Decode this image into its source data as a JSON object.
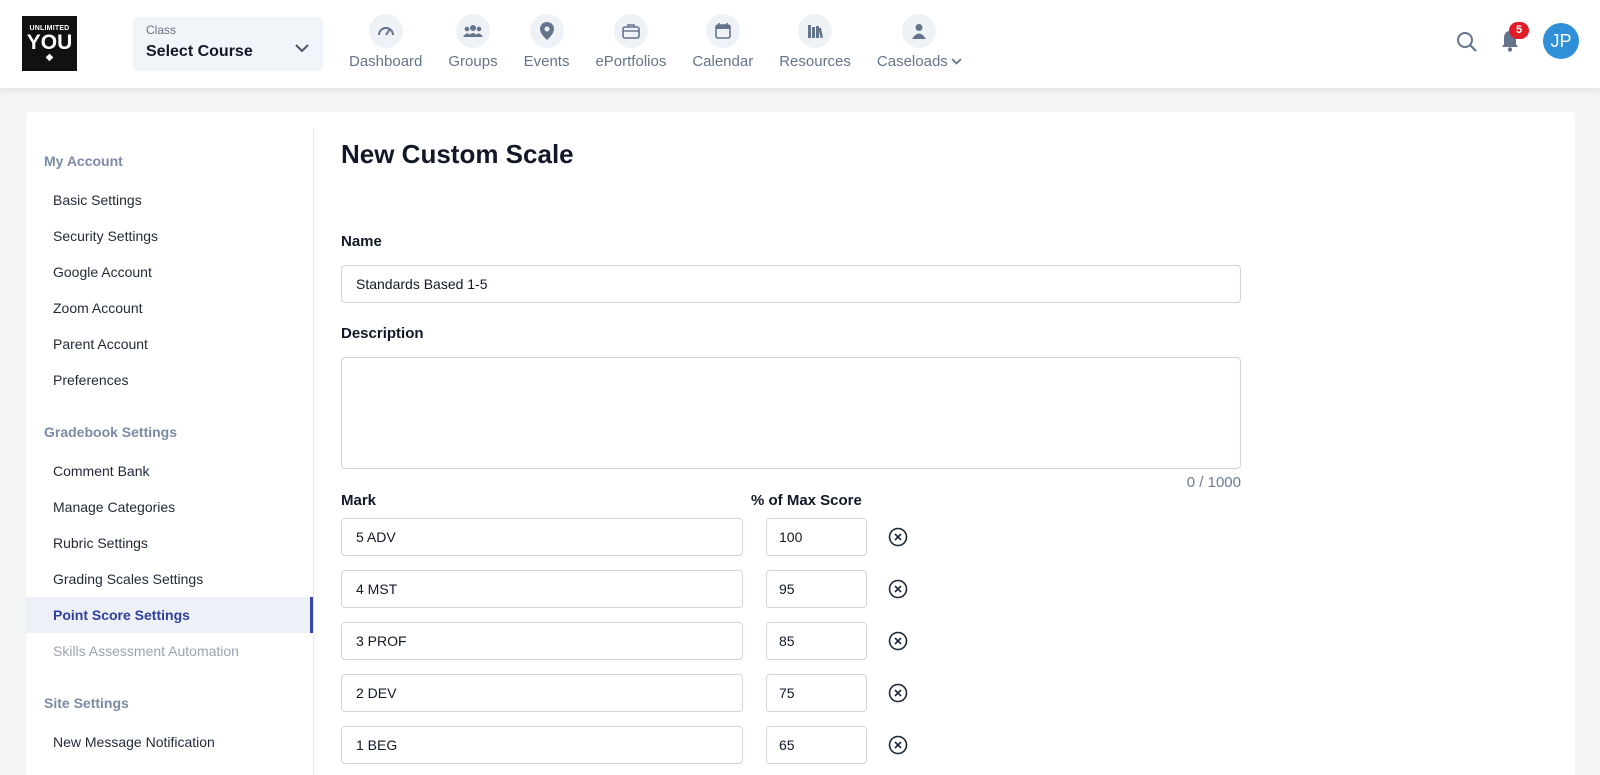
{
  "header": {
    "logo": {
      "line1": "UNLIMITED",
      "line2": "YOU"
    },
    "course_selector": {
      "label": "Class",
      "value": "Select Course"
    },
    "nav": [
      {
        "label": "Dashboard",
        "icon": "dashboard-icon"
      },
      {
        "label": "Groups",
        "icon": "groups-icon"
      },
      {
        "label": "Events",
        "icon": "map-pin-icon"
      },
      {
        "label": "ePortfolios",
        "icon": "briefcase-icon"
      },
      {
        "label": "Calendar",
        "icon": "calendar-icon"
      },
      {
        "label": "Resources",
        "icon": "books-icon"
      },
      {
        "label": "Caseloads",
        "icon": "person-icon"
      }
    ],
    "notification_count": "5",
    "avatar_initials": "JP"
  },
  "sidebar": {
    "sections": [
      {
        "title": "My Account",
        "items": [
          "Basic Settings",
          "Security Settings",
          "Google Account",
          "Zoom Account",
          "Parent Account",
          "Preferences"
        ]
      },
      {
        "title": "Gradebook Settings",
        "items": [
          "Comment Bank",
          "Manage Categories",
          "Rubric Settings",
          "Grading Scales Settings",
          "Point Score Settings",
          "Skills Assessment Automation"
        ]
      },
      {
        "title": "Site Settings",
        "items": [
          "New Message Notification"
        ]
      }
    ],
    "active_item": "Point Score Settings",
    "disabled_item": "Skills Assessment Automation"
  },
  "form": {
    "title": "New Custom Scale",
    "name_label": "Name",
    "name_value": "Standards Based 1-5",
    "description_label": "Description",
    "description_value": "",
    "description_counter": "0 / 1000",
    "mark_header": "Mark",
    "pct_header": "% of Max Score",
    "rows": [
      {
        "mark": "5 ADV",
        "pct": "100"
      },
      {
        "mark": "4 MST",
        "pct": "95"
      },
      {
        "mark": "3 PROF",
        "pct": "85"
      },
      {
        "mark": "2 DEV",
        "pct": "75"
      },
      {
        "mark": "1 BEG",
        "pct": "65"
      }
    ]
  },
  "colors": {
    "accent": "#3a49a8",
    "avatar": "#2f8fd8",
    "badge": "#e11d2a",
    "section_title": "#7b8aa5"
  }
}
